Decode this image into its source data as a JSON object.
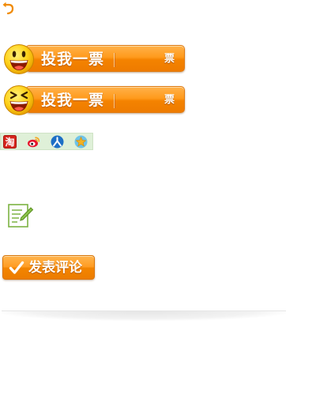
{
  "vote_buttons": [
    {
      "label": "投我一票",
      "count_label": "票",
      "face": "smile"
    },
    {
      "label": "投我一票",
      "count_label": "票",
      "face": "laugh"
    }
  ],
  "share": {
    "items": [
      {
        "label": "淘",
        "name": "taobao-icon",
        "color": "#d6261d"
      },
      {
        "name": "weibo-icon",
        "color": "#e6162d"
      },
      {
        "name": "renren-icon",
        "color": "#1d6fc5"
      },
      {
        "name": "qzone-icon",
        "color": "#f3b120"
      }
    ]
  },
  "submit_button": {
    "label": "发表评论"
  },
  "colors": {
    "accent": "#f48300",
    "share_bg": "#dff0d8"
  }
}
